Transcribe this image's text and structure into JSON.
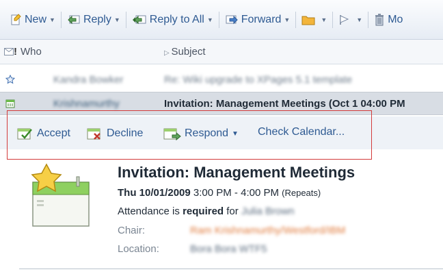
{
  "toolbar": {
    "new_label": "New",
    "reply_label": "Reply",
    "reply_all_label": "Reply to All",
    "forward_label": "Forward",
    "more_label": "Mo"
  },
  "columns": {
    "who": "Who",
    "subject": "Subject"
  },
  "rows": [
    {
      "who": "Kandra Bowker",
      "subject": "Re: Wiki upgrade to XPages 5.1 template"
    },
    {
      "who": "Krishnamurthy",
      "subject": "Invitation: Management Meetings (Oct 1 04:00 PM"
    }
  ],
  "actions": {
    "accept": "Accept",
    "decline": "Decline",
    "respond": "Respond",
    "check_calendar": "Check Calendar..."
  },
  "invite": {
    "title": "Invitation: Management Meetings",
    "date": "Thu 10/01/2009",
    "time": "3:00 PM - 4:00 PM",
    "repeats": "(Repeats)",
    "attendance_prefix": "Attendance is",
    "attendance_required": "required",
    "attendance_for": "for",
    "attendee": "Julia Brown",
    "chair_label": "Chair:",
    "chair": "Ram Krishnamurthy/Westford/IBM",
    "location_label": "Location:",
    "location": "Bora Bora WTF5"
  },
  "colors": {
    "accent": "#2e5a92",
    "highlight_box": "#d33a3a",
    "selected_row": "#d8dde4"
  }
}
